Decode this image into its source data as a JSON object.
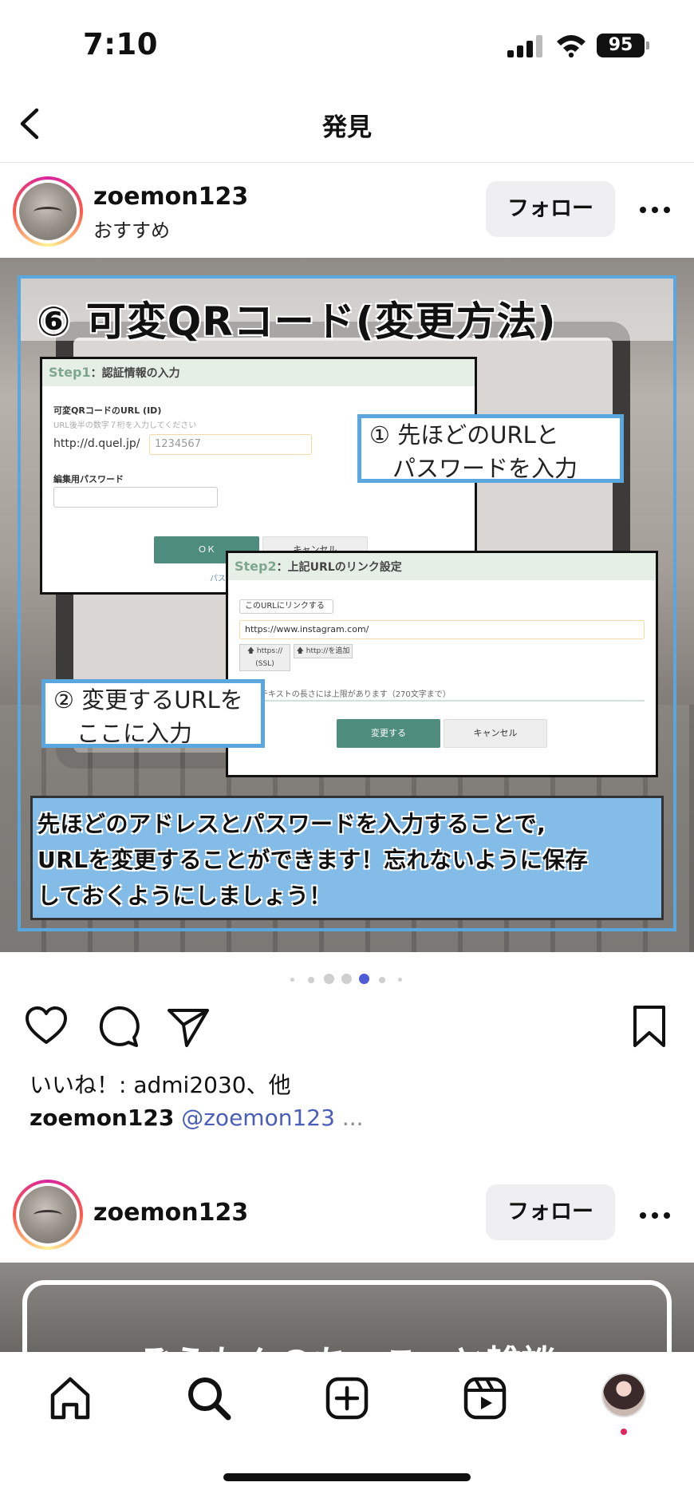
{
  "status_bar": {
    "time": "7:10",
    "battery": "95"
  },
  "nav": {
    "title": "発見"
  },
  "post1": {
    "username": "zoemon123",
    "subtitle": "おすすめ",
    "follow_label": "フォロー",
    "image": {
      "headline": "⑥ 可変QRコード(変更方法)",
      "step1": {
        "step_word": "Step",
        "step_num": "1",
        "title": "：認証情報の入力",
        "field_label": "可変QRコードのURL (ID)",
        "field_hint": "URL後半の数字７桁を入力してください",
        "url_prefix": "http://d.quel.jp/",
        "id_placeholder": "1234567",
        "password_label": "編集用パスワード",
        "ok_label": "ＯＫ",
        "cancel_label": "キャンセル",
        "truncated_text": "パス"
      },
      "step2": {
        "step_word": "Step",
        "step_num": "2",
        "title": "：上記URLのリンク設定",
        "select_value": "このURLにリンクする",
        "url_value": "https://www.instagram.com/",
        "chip_ssl": "🡅 https:// (SSL)",
        "chip_http": "🡅 http://を追加",
        "note": "テキストの長さには上限があります（270文字まで）",
        "change_label": "変更する",
        "cancel_label": "キャンセル"
      },
      "callout1": [
        "① 先ほどのURLと",
        "　パスワードを入力"
      ],
      "callout2": [
        "② 変更するURLを",
        "　ここに入力"
      ],
      "caption_lines": [
        "先ほどのアドレスとパスワードを入力することで,",
        "URLを変更することができます！忘れないように保存",
        "しておくようにしましょう！"
      ]
    },
    "carousel": {
      "count": 7,
      "active_index": 4
    },
    "likes_text": "いいね！: admi2030、他",
    "caption_user": "zoemon123",
    "caption_mention": "@zoemon123",
    "caption_more": " ..."
  },
  "post2": {
    "username": "zoemon123",
    "follow_label": "フォロー",
    "image_title": "ぞうもんのちょこっと雑談"
  },
  "icons": {
    "back": "chevron-left-icon",
    "like": "heart-icon",
    "comment": "comment-icon",
    "share": "send-icon",
    "save": "bookmark-icon",
    "home": "home-icon",
    "search": "search-icon",
    "create": "plus-square-icon",
    "reels": "reels-icon"
  },
  "colors": {
    "accent_blue": "#5aa7e0",
    "caption_box": "#84bce8",
    "mention": "#4a5db8",
    "carousel_active": "#4d5bd6",
    "notification": "#e0245e"
  }
}
